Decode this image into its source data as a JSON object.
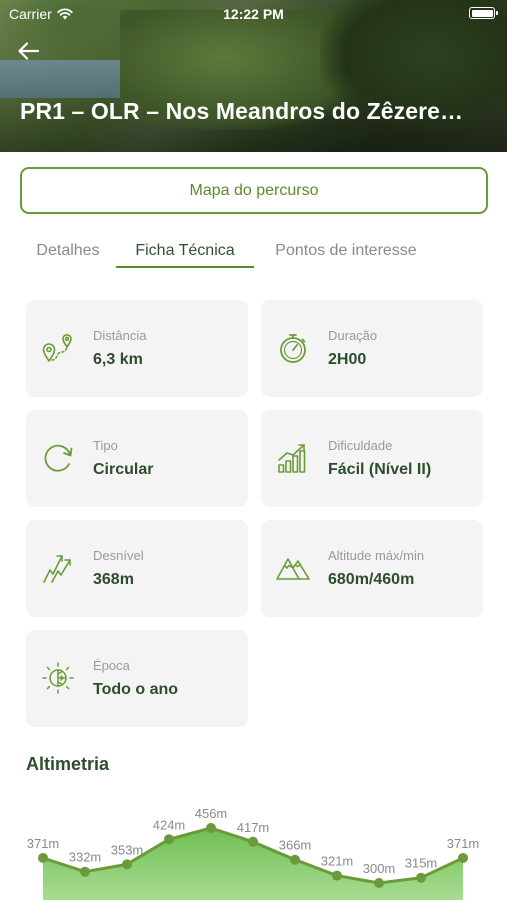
{
  "status_bar": {
    "carrier": "Carrier",
    "time": "12:22 PM"
  },
  "header": {
    "title": "PR1 – OLR – Nos Meandros do Zêzere…"
  },
  "map_button": {
    "label": "Mapa do percurso"
  },
  "tabs": [
    {
      "label": "Detalhes",
      "active": false
    },
    {
      "label": "Ficha Técnica",
      "active": true
    },
    {
      "label": "Pontos de interesse",
      "active": false
    }
  ],
  "specs": [
    {
      "label": "Distância",
      "value": "6,3 km",
      "icon": "map-pin-route-icon"
    },
    {
      "label": "Duração",
      "value": "2H00",
      "icon": "stopwatch-icon"
    },
    {
      "label": "Tipo",
      "value": "Circular",
      "icon": "circular-arrow-icon"
    },
    {
      "label": "Dificuldade",
      "value": "Fácil (Nível II)",
      "icon": "bar-chart-trend-icon"
    },
    {
      "label": "Desnível",
      "value": "368m",
      "icon": "elevation-arrows-icon"
    },
    {
      "label": "Altitude máx/min",
      "value": "680m/460m",
      "icon": "mountains-icon"
    },
    {
      "label": "Época",
      "value": "Todo o ano",
      "icon": "sun-snowflake-icon"
    }
  ],
  "altimetry": {
    "title": "Altimetria",
    "points": [
      {
        "label": "371m",
        "value": 371
      },
      {
        "label": "332m",
        "value": 332
      },
      {
        "label": "353m",
        "value": 353
      },
      {
        "label": "424m",
        "value": 424
      },
      {
        "label": "456m",
        "value": 456
      },
      {
        "label": "417m",
        "value": 417
      },
      {
        "label": "366m",
        "value": 366
      },
      {
        "label": "321m",
        "value": 321
      },
      {
        "label": "300m",
        "value": 300
      },
      {
        "label": "315m",
        "value": 315
      },
      {
        "label": "371m",
        "value": 371
      }
    ]
  },
  "colors": {
    "accent": "#5b8a2e",
    "dark_text": "#2e4d2d",
    "card_bg": "#f4f4f4"
  }
}
